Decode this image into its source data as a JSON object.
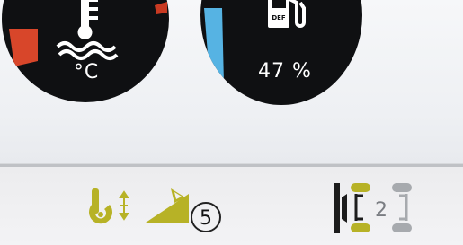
{
  "gauges": {
    "coolant_temp": {
      "unit": "°C",
      "icon": "coolant-temperature-icon"
    },
    "def_level": {
      "readout": "47 %",
      "icon_label": "DEF",
      "icon": "def-tank-icon",
      "level_fraction": 0.47
    }
  },
  "status_bar": {
    "callout_number": "5",
    "drive_position": "2",
    "icons": [
      "hitch-lift-icon",
      "ramp-slope-icon",
      "steering-mode-icon"
    ]
  },
  "colors": {
    "gauge_face": "#0f1012",
    "temp_warning": "#d8462a",
    "def_fill": "#56b3e3",
    "indicator_olive": "#b7b226",
    "wheel_gray": "#a7aaae"
  }
}
